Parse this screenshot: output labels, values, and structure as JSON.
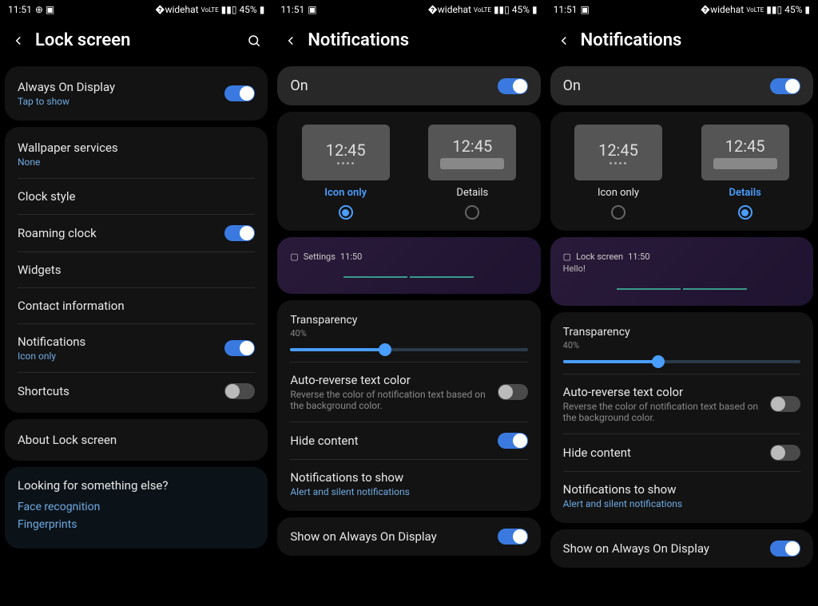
{
  "status": {
    "time": "11:51",
    "battery": "45%",
    "net": "VoLTE"
  },
  "panel1": {
    "title": "Lock screen",
    "group1": {
      "aod": "Always On Display",
      "aod_sub": "Tap to show",
      "aod_on": true
    },
    "group2": {
      "wallpaper": "Wallpaper services",
      "wallpaper_sub": "None",
      "clock": "Clock style",
      "roaming": "Roaming clock",
      "roaming_on": true,
      "widgets": "Widgets",
      "contact": "Contact information",
      "notif": "Notifications",
      "notif_sub": "Icon only",
      "notif_on": true,
      "shortcuts": "Shortcuts",
      "shortcuts_on": false
    },
    "about": "About Lock screen",
    "looking": {
      "title": "Looking for something else?",
      "face": "Face recognition",
      "finger": "Fingerprints"
    }
  },
  "panel2": {
    "title": "Notifications",
    "on_label": "On",
    "on_state": true,
    "style": {
      "time": "12:45",
      "icon_only": "Icon only",
      "details": "Details",
      "selected": "icon"
    },
    "preview": {
      "app": "Settings",
      "time": "11:50"
    },
    "transparency": {
      "title": "Transparency",
      "value": "40%",
      "pct": 40
    },
    "auto_reverse": {
      "title": "Auto-reverse text color",
      "desc": "Reverse the color of notification text based on the background color.",
      "on": false
    },
    "hide": {
      "title": "Hide content",
      "on": true
    },
    "to_show": {
      "title": "Notifications to show",
      "sub": "Alert and silent notifications"
    },
    "aod": {
      "title": "Show on Always On Display",
      "on": true
    }
  },
  "panel3": {
    "title": "Notifications",
    "on_label": "On",
    "on_state": true,
    "style": {
      "time": "12:45",
      "icon_only": "Icon only",
      "details": "Details",
      "selected": "details"
    },
    "preview": {
      "app": "Lock screen",
      "time": "11:50",
      "msg": "Hello!"
    },
    "transparency": {
      "title": "Transparency",
      "value": "40%",
      "pct": 40
    },
    "auto_reverse": {
      "title": "Auto-reverse text color",
      "desc": "Reverse the color of notification text based on the background color.",
      "on": false
    },
    "hide": {
      "title": "Hide content",
      "on": false
    },
    "to_show": {
      "title": "Notifications to show",
      "sub": "Alert and silent notifications"
    },
    "aod": {
      "title": "Show on Always On Display",
      "on": true
    }
  }
}
